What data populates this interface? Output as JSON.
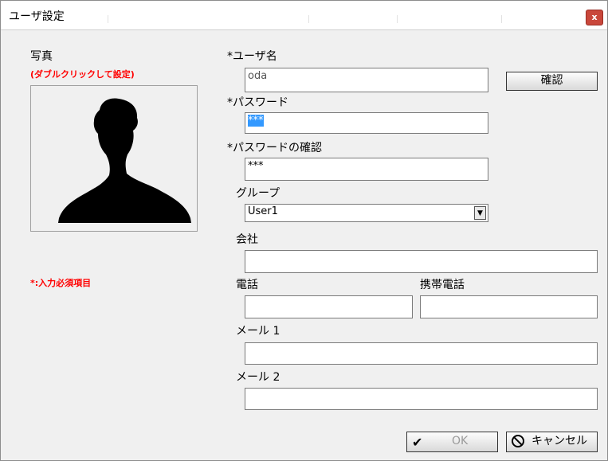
{
  "window": {
    "title": "ユーザ設定",
    "close_glyph": "x"
  },
  "photo": {
    "label": "写真",
    "hint": "(ダブルクリックして設定)"
  },
  "required_note": "*:入力必須項目",
  "fields": {
    "username": {
      "label": "*ユーザ名",
      "value": "oda"
    },
    "password": {
      "label": "*パスワード",
      "value": "***"
    },
    "password_confirm": {
      "label": "*パスワードの確認",
      "value": "***"
    },
    "group": {
      "label": "グループ",
      "value": "User1"
    },
    "company": {
      "label": "会社",
      "value": ""
    },
    "phone": {
      "label": "電話",
      "value": ""
    },
    "mobile": {
      "label": "携帯電話",
      "value": ""
    },
    "mail1": {
      "label": "メール 1",
      "value": ""
    },
    "mail2": {
      "label": "メール 2",
      "value": ""
    }
  },
  "buttons": {
    "confirm": "確認",
    "ok": "OK",
    "cancel": "キャンセル"
  },
  "icons": {
    "ok": "check-icon",
    "cancel": "no-entry-icon",
    "dropdown": "chevron-down-icon"
  }
}
